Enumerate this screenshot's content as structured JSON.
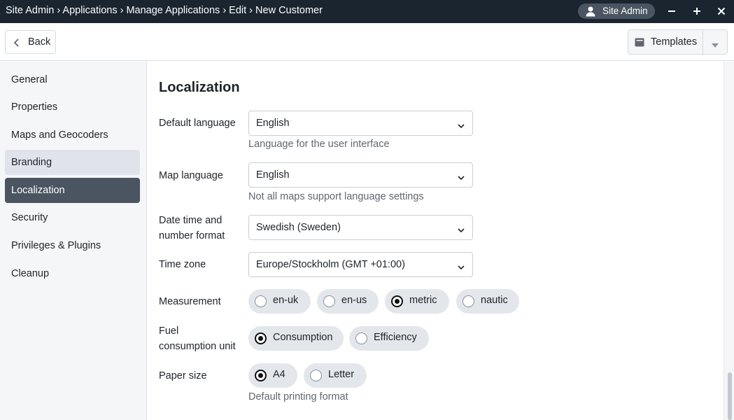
{
  "titlebar": {
    "breadcrumb": "Site Admin › Applications › Manage Applications › Edit › New Customer",
    "user": "Site Admin",
    "icons": [
      "user-icon",
      "minimize-icon",
      "plus-icon",
      "close-icon"
    ]
  },
  "toolbar": {
    "back_label": "Back",
    "templates_label": "Templates"
  },
  "sidebar": {
    "items": [
      {
        "label": "General",
        "state": "normal"
      },
      {
        "label": "Properties",
        "state": "normal"
      },
      {
        "label": "Maps and Geocoders",
        "state": "normal"
      },
      {
        "label": "Branding",
        "state": "hover"
      },
      {
        "label": "Localization",
        "state": "active"
      },
      {
        "label": "Security",
        "state": "normal"
      },
      {
        "label": "Privileges & Plugins",
        "state": "normal"
      },
      {
        "label": "Cleanup",
        "state": "normal"
      }
    ]
  },
  "main": {
    "title": "Localization",
    "default_language": {
      "label": "Default language",
      "value": "English",
      "helper": "Language for the user interface"
    },
    "map_language": {
      "label": "Map language",
      "value": "English",
      "helper": "Not all maps support language settings"
    },
    "date_format": {
      "label_line1": "Date time and",
      "label_line2": "number format",
      "value": "Swedish (Sweden)"
    },
    "time_zone": {
      "label": "Time zone",
      "value": "Europe/Stockholm (GMT +01:00)"
    },
    "measurement": {
      "label": "Measurement",
      "options": [
        "en-uk",
        "en-us",
        "metric",
        "nautic"
      ],
      "selected": "metric"
    },
    "fuel": {
      "label_line1": "Fuel",
      "label_line2": "consumption unit",
      "options": [
        "Consumption",
        "Efficiency"
      ],
      "selected": "Consumption"
    },
    "paper": {
      "label": "Paper size",
      "options": [
        "A4",
        "Letter"
      ],
      "selected": "A4",
      "helper": "Default printing format"
    }
  },
  "colors": {
    "titlebar_bg": "#1a2530",
    "active_nav_bg": "#4a5561",
    "radio_bg": "#e3e7ec"
  }
}
